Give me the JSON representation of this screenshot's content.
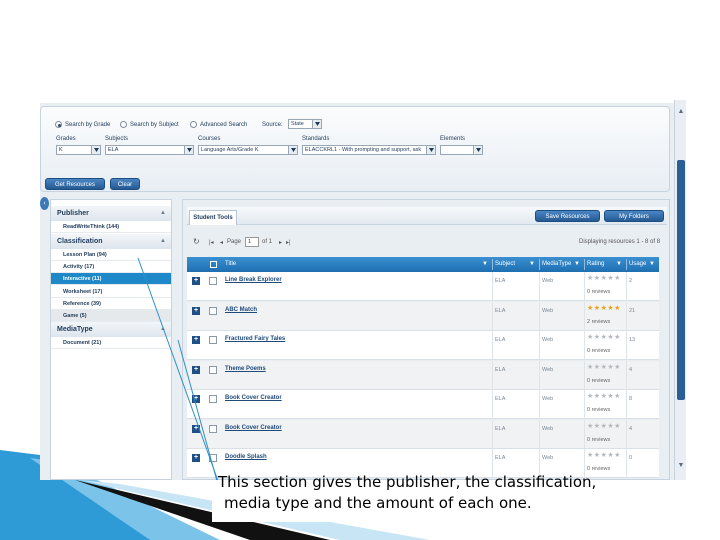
{
  "search": {
    "modes": [
      "Search by Grade",
      "Search by Subject",
      "Advanced Search"
    ],
    "source_label": "Source:",
    "source_value": "State",
    "labels": {
      "grades": "Grades",
      "subjects": "Subjects",
      "courses": "Courses",
      "standards": "Standards",
      "elements": "Elements"
    },
    "values": {
      "grades": "K",
      "subjects": "ELA",
      "courses": "Language Arts/Grade K",
      "standards": "ELACCKRL1 - With prompting and support, ask",
      "elements": ""
    },
    "get_resources": "Get Resources",
    "clear": "Clear"
  },
  "sidebar": {
    "publisher_head": "Publisher",
    "publisher_items": [
      "ReadWriteThink (144)"
    ],
    "classification_head": "Classification",
    "classification_items": [
      "Lesson Plan (94)",
      "Activity (17)",
      "Interactive (11)",
      "Worksheet (17)",
      "Reference (39)",
      "Game (5)"
    ],
    "mediatype_head": "MediaType",
    "mediatype_items": [
      "Document (21)"
    ]
  },
  "main": {
    "tab": "Student Tools",
    "save_resources": "Save Resources",
    "my_folders": "My Folders",
    "pager": {
      "page_label": "Page",
      "page_value": "1",
      "of_label": "of 1",
      "displaying": "Displaying resources 1 - 8 of 8"
    },
    "columns": {
      "title": "Title",
      "subject": "Subject",
      "media": "MediaType",
      "rating": "Rating",
      "usage": "Usage"
    },
    "rows": [
      {
        "title": "Line Break Explorer",
        "subject": "ELA",
        "media": "Web",
        "stars": 0,
        "reviews": "0 reviews",
        "usage": "2"
      },
      {
        "title": "ABC Match",
        "subject": "ELA",
        "media": "Web",
        "stars": 5,
        "reviews": "2 reviews",
        "usage": "21"
      },
      {
        "title": "Fractured Fairy Tales",
        "subject": "ELA",
        "media": "Web",
        "stars": 0,
        "reviews": "0 reviews",
        "usage": "13"
      },
      {
        "title": "Theme Poems",
        "subject": "ELA",
        "media": "Web",
        "stars": 0,
        "reviews": "0 reviews",
        "usage": "4"
      },
      {
        "title": "Book Cover Creator",
        "subject": "ELA",
        "media": "Web",
        "stars": 0,
        "reviews": "0 reviews",
        "usage": "8"
      },
      {
        "title": "Book Cover Creator",
        "subject": "ELA",
        "media": "Web",
        "stars": 0,
        "reviews": "0 reviews",
        "usage": "4"
      },
      {
        "title": "Doodle Splash",
        "subject": "ELA",
        "media": "Web",
        "stars": 0,
        "reviews": "0 reviews",
        "usage": "0"
      }
    ]
  },
  "caption": {
    "line1": "This section gives the publisher, the classification,",
    "line2": "media type and the amount of each one."
  },
  "colors": {
    "accent": "#1e88c8",
    "header_blue": "#1e6fb0",
    "button_blue": "#255a92",
    "star": "#e8a21b"
  }
}
